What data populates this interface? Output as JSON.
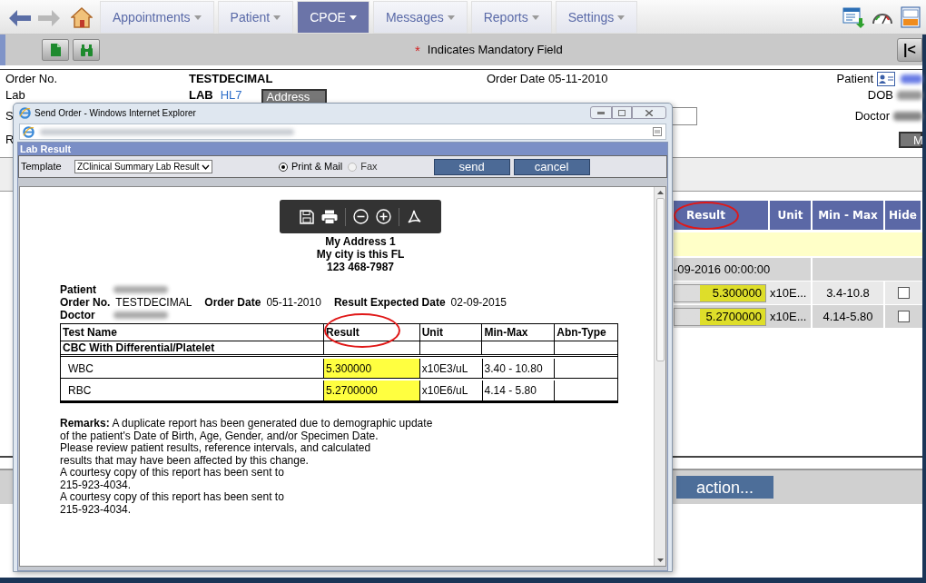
{
  "nav": {
    "menus": [
      {
        "label": "Appointments",
        "selected": false
      },
      {
        "label": "Patient",
        "selected": false
      },
      {
        "label": "CPOE",
        "selected": true
      },
      {
        "label": "Messages",
        "selected": false
      },
      {
        "label": "Reports",
        "selected": false
      },
      {
        "label": "Settings",
        "selected": false
      }
    ]
  },
  "toolbar": {
    "mandatory_mark": "*",
    "mandatory_note": "Indicates Mandatory Field",
    "collapse_button": "|<"
  },
  "order_form": {
    "order_no_label": "Order No.",
    "order_no": "TESTDECIMAL",
    "order_date": "Order Date 05-11-2010",
    "patient_label": "Patient",
    "patient_redacted": true,
    "lab_label": "Lab",
    "lab": "LAB",
    "lab_link": "HL7",
    "address_button": "Address",
    "dob_label": "DOB",
    "dob_redacted": true,
    "row_3_label": "S",
    "doctor_label": "Doctor",
    "doctor_redacted": true,
    "row_4_label": "R",
    "row_4_button": "M"
  },
  "results_table": {
    "columns": [
      {
        "label": "Result",
        "circled": true
      },
      {
        "label": "Unit",
        "circled": false
      },
      {
        "label": "Min - Max",
        "circled": false
      },
      {
        "label": "Hide",
        "circled": false
      }
    ],
    "group_date": "-09-2016 00:00:00",
    "rows": [
      {
        "result": "5.300000",
        "highlighted": true,
        "unit": "x10E...",
        "range": "3.4-10.8",
        "hide": false
      },
      {
        "result": "5.2700000",
        "highlighted": true,
        "unit": "x10E...",
        "range": "4.14-5.80",
        "hide": false
      }
    ]
  },
  "action_button": "action...",
  "popup": {
    "title": "Send Order - Windows Internet Explorer",
    "url_redacted": true,
    "panel_title": "Lab Result",
    "template_label": "Template",
    "template": "ZClinical Summary Lab Result",
    "delivery": [
      {
        "label": "Print & Mail",
        "selected": true
      },
      {
        "label": "Fax",
        "selected": false
      }
    ],
    "buttons": [
      "send",
      "cancel"
    ],
    "report": {
      "address_lines": [
        "My Address 1",
        "My city is this FL",
        "123 468-7987"
      ],
      "info_lines": [
        [
          {
            "label": "Patient",
            "redacted": true
          }
        ],
        [
          {
            "label": "Order No.",
            "value": "TESTDECIMAL"
          },
          {
            "label": "Order Date",
            "value": "05-11-2010"
          },
          {
            "label": "Result Expected Date",
            "value": "02-09-2015"
          }
        ],
        [
          {
            "label": "Doctor",
            "redacted": true
          }
        ]
      ],
      "table": {
        "columns": [
          {
            "label": "Test Name",
            "circled": false
          },
          {
            "label": "Result",
            "circled": true
          },
          {
            "label": "Unit",
            "circled": false
          },
          {
            "label": "Min-Max",
            "circled": false
          },
          {
            "label": "Abn-Type",
            "circled": false
          }
        ],
        "group": "CBC With Differential/Platelet",
        "rows": [
          {
            "test": "WBC",
            "result": "5.300000",
            "highlighted": true,
            "unit": "x10E3/uL",
            "range": "3.40 - 10.80"
          },
          {
            "test": "RBC",
            "result": "5.2700000",
            "highlighted": true,
            "unit": "x10E6/uL",
            "range": "4.14 - 5.80"
          }
        ]
      },
      "remarks": "**Remarks:**  A duplicate report has been generated due to demographic update\nof the patient's Date of Birth, Age, Gender, and/or Specimen Date.\nPlease review patient results, reference intervals, and calculated\nresults that may have been affected by this change.\nA courtesy copy of this report has been sent to\n215-923-4034.\nA courtesy copy of this report has been sent to\n215-923-4034."
    }
  }
}
